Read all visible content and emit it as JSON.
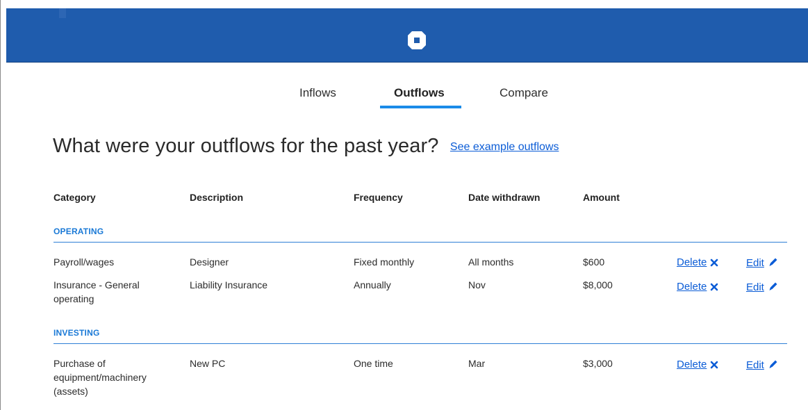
{
  "header": {
    "logo_icon": "bank-octagon-logo-icon",
    "background_color": "#1f5cad"
  },
  "tabs": [
    {
      "label": "Inflows",
      "active": false
    },
    {
      "label": "Outflows",
      "active": true
    },
    {
      "label": "Compare",
      "active": false
    }
  ],
  "accent_color": "#1a8be8",
  "page": {
    "title": "What were your outflows for the past year?",
    "example_link": "See example outflows"
  },
  "table": {
    "columns": [
      "Category",
      "Description",
      "Frequency",
      "Date withdrawn",
      "Amount"
    ],
    "sections": [
      {
        "label": "OPERATING",
        "rows": [
          {
            "category": "Payroll/wages",
            "description": "Designer",
            "frequency": "Fixed monthly",
            "date": "All months",
            "amount": "$600"
          },
          {
            "category": "Insurance - General operating",
            "description": "Liability Insurance",
            "frequency": "Annually",
            "date": "Nov",
            "amount": "$8,000"
          }
        ]
      },
      {
        "label": "INVESTING",
        "rows": [
          {
            "category": "Purchase of equipment/machinery (assets)",
            "description": "New PC",
            "frequency": "One time",
            "date": "Mar",
            "amount": "$3,000"
          }
        ]
      }
    ],
    "delete_label": "Delete",
    "edit_label": "Edit",
    "delete_icon": "close-x-icon",
    "edit_icon": "pencil-icon"
  }
}
